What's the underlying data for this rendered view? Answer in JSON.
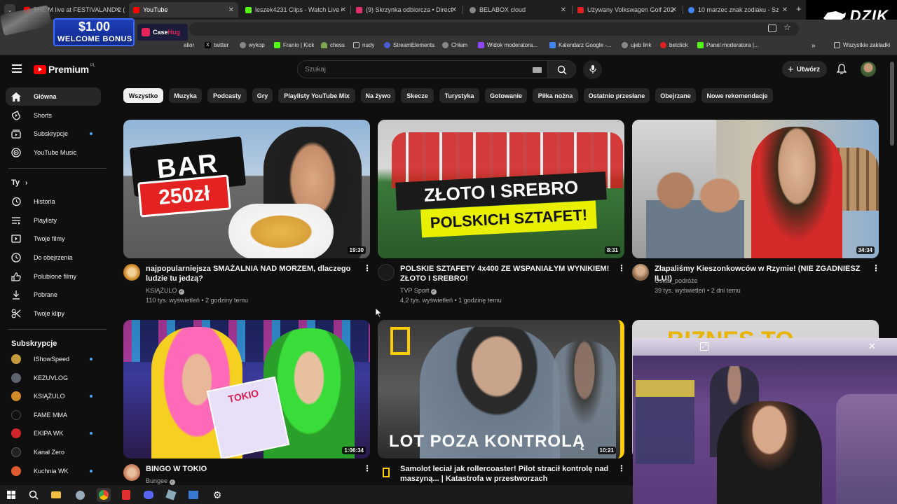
{
  "browser": {
    "tabs": [
      {
        "label": "THE M live at FESTIVALAND 2 (f",
        "color": "#ff0000"
      },
      {
        "label": "YouTube",
        "color": "#ff0000",
        "active": true
      },
      {
        "label": "leszek4231 Clips - Watch Live o",
        "color": "#53fc18"
      },
      {
        "label": "(9) Skrzynka odbiorcza • Direct",
        "color": "#e1306c"
      },
      {
        "label": "BELABOX cloud",
        "color": "#888888"
      },
      {
        "label": "Używany Volkswagen Golf 2024-",
        "color": "#e02020"
      },
      {
        "label": "10 marzec znak zodiaku - Szuk",
        "color": "#4285f4"
      }
    ],
    "bookmarks": [
      {
        "label": "alior",
        "color": "#b0b0b0"
      },
      {
        "label": "twitter",
        "color": "#000000"
      },
      {
        "label": "wykop",
        "color": "#888888"
      },
      {
        "label": "Franio | Kick",
        "color": "#53fc18"
      },
      {
        "label": "chess",
        "color": "#7fa650"
      },
      {
        "label": "nudy",
        "color": "#888888"
      },
      {
        "label": "StreamElements",
        "color": "#4b5bd6"
      },
      {
        "label": "Chłam",
        "color": "#888888"
      },
      {
        "label": "Widok moderatora...",
        "color": "#9146ff"
      },
      {
        "label": "Kalendarz Google -...",
        "color": "#4285f4"
      },
      {
        "label": "ujeb link",
        "color": "#888888"
      },
      {
        "label": "betclick",
        "color": "#e02020"
      },
      {
        "label": "Panel moderatora |...",
        "color": "#53fc18"
      },
      {
        "label": "Wszystkie zakładki",
        "color": "#888888"
      }
    ]
  },
  "overlay": {
    "promo_amount": "$1.00",
    "promo_text": "WELCOME BONUS",
    "promo_brand": "Case",
    "promo_brand2": "Hug",
    "brand_logo": "DZIK"
  },
  "youtube": {
    "logo_text": "Premium",
    "logo_region": "PL",
    "search_placeholder": "Szukaj",
    "create_label": "Utwórz",
    "colors": {
      "accent_red": "#ff0000",
      "chip_active_bg": "#f1f1f1",
      "dot_blue": "#3ea6ff"
    },
    "sidebar": {
      "main": [
        {
          "label": "Główna",
          "icon": "home-icon",
          "active": true
        },
        {
          "label": "Shorts",
          "icon": "shorts-icon"
        },
        {
          "label": "Subskrypcje",
          "icon": "subscriptions-icon",
          "dot": true
        },
        {
          "label": "YouTube Music",
          "icon": "music-icon"
        }
      ],
      "you_heading": "Ty",
      "you": [
        {
          "label": "Historia",
          "icon": "history-icon"
        },
        {
          "label": "Playlisty",
          "icon": "playlist-icon"
        },
        {
          "label": "Twoje filmy",
          "icon": "your-videos-icon"
        },
        {
          "label": "Do obejrzenia",
          "icon": "watch-later-icon"
        },
        {
          "label": "Polubione filmy",
          "icon": "like-icon"
        },
        {
          "label": "Pobrane",
          "icon": "download-icon"
        },
        {
          "label": "Twoje klipy",
          "icon": "clips-icon"
        }
      ],
      "subs_heading": "Subskrypcje",
      "subs": [
        {
          "label": "IShowSpeed",
          "color": "#c59a3d",
          "dot": true
        },
        {
          "label": "KEZUVLOG",
          "color": "#5d6470"
        },
        {
          "label": "KSIĄŻULO",
          "color": "#d08a2a",
          "dot": true
        },
        {
          "label": "FAME MMA",
          "color": "#111111"
        },
        {
          "label": "EKIPA WK",
          "color": "#d0262a",
          "dot": true
        },
        {
          "label": "Kanał Zero",
          "color": "#222222"
        },
        {
          "label": "Kuchnia WK",
          "color": "#e05a30",
          "dot": true
        }
      ]
    },
    "chips": [
      "Wszystko",
      "Muzyka",
      "Podcasty",
      "Gry",
      "Playlisty YouTube Mix",
      "Na żywo",
      "Skecze",
      "Turystyka",
      "Gotowanie",
      "Piłka nożna",
      "Ostatnio przesłane",
      "Obejrzane",
      "Nowe rekomendacje"
    ],
    "videos": [
      {
        "title": "najpopularniejsza SMAŻALNIA NAD MORZEM, dlaczego ludzie tu jedzą?",
        "channel": "KSIĄŻULO",
        "verified": true,
        "views": "110 tys. wyświetleń",
        "age": "2 godziny temu",
        "duration": "19:30",
        "thumb_text": "BAR",
        "thumb_text2": "250zł",
        "avatar_color": "#d08a2a"
      },
      {
        "title": "POLSKIE SZTAFETY 4x400 ZE WSPANIAŁYM WYNIKIEM! ZŁOTO I SREBRO!",
        "channel": "TVP Sport",
        "verified": true,
        "views": "4,2 tys. wyświetleń",
        "age": "1 godzinę temu",
        "duration": "8:31",
        "thumb_text": "ZŁOTO I SREBRO",
        "thumb_text2": "POLSKICH SZTAFET!",
        "avatar_color": "#1a1a1a"
      },
      {
        "title": "Złapaliśmy Kieszonkowców w Rzymie! (NIE ZGADNIESZ ILU!)",
        "channel": "Oskar_podróże",
        "verified": false,
        "views": "39 tys. wyświetleń",
        "age": "2 dni temu",
        "duration": "34:34",
        "thumb_text": "",
        "thumb_text2": "",
        "avatar_color": "#8a6a4a"
      },
      {
        "title": "BINGO W TOKIO",
        "channel": "Bungee",
        "verified": true,
        "views": "",
        "age": "",
        "duration": "1:06:34",
        "thumb_text": "TOKIO",
        "thumb_text2": "",
        "avatar_color": "#c77a56"
      },
      {
        "title": "Samolot leciał jak rollercoaster! Pilot stracił kontrolę nad maszyną... | Katastrofa w przestworzach",
        "channel": "",
        "verified": false,
        "views": "",
        "age": "",
        "duration": "10:21",
        "thumb_text": "LOT POZA KONTROLĄ",
        "thumb_text2": "",
        "avatar_color": "#ffcc00"
      }
    ],
    "third_row_partial_text": "BIZNES TO"
  }
}
